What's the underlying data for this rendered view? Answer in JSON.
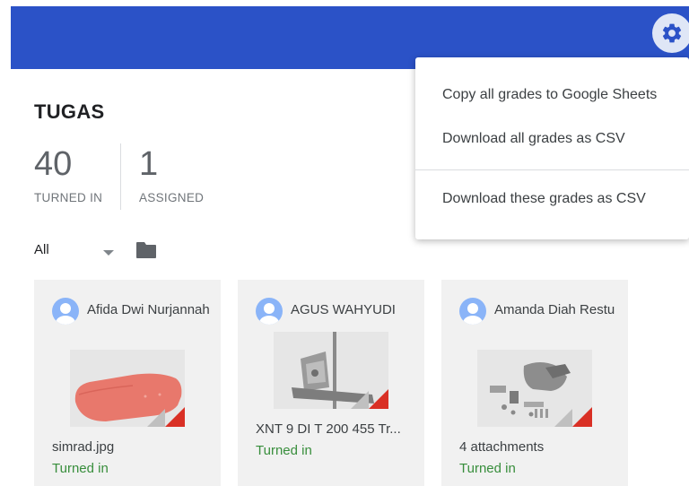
{
  "page": {
    "title": "TUGAS"
  },
  "stats": [
    {
      "value": "40",
      "label": "TURNED IN"
    },
    {
      "value": "1",
      "label": "ASSIGNED"
    }
  ],
  "filter": {
    "selected": "All"
  },
  "icons": {
    "settings": "gear-icon",
    "folder": "folder-icon",
    "avatar": "person-icon"
  },
  "colors": {
    "header": "#2b52c7",
    "status_green": "#388e3c",
    "card_bg": "#f1f1f1"
  },
  "cards": [
    {
      "name": "Afida Dwi Nurjannah",
      "file": "simrad.jpg",
      "status": "Turned in"
    },
    {
      "name": "AGUS WAHYUDI",
      "file": "XNT 9 DI T 200 455 Tr...",
      "status": "Turned in"
    },
    {
      "name": "Amanda Diah Restu",
      "file": "4 attachments",
      "status": "Turned in"
    }
  ],
  "menu": {
    "items": [
      "Copy all grades to Google Sheets",
      "Download all grades as CSV",
      "Download these grades as CSV"
    ]
  }
}
